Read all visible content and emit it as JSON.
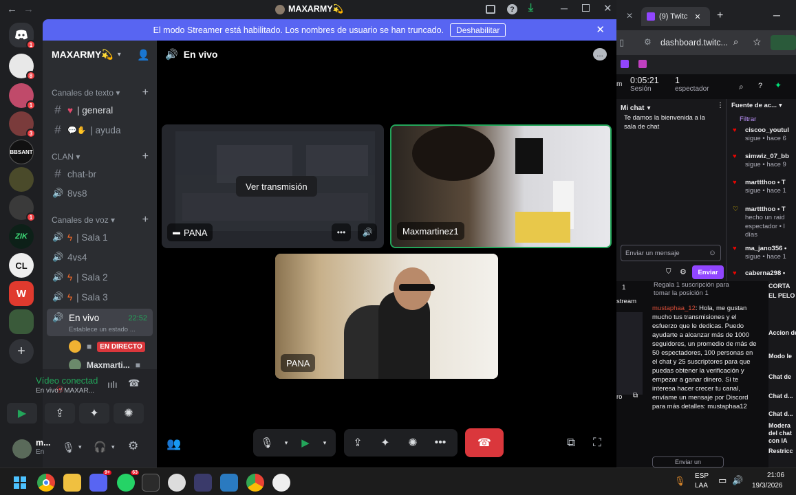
{
  "window": {
    "title": "MAXARMY💫"
  },
  "banner": {
    "text": "El modo Streamer está habilitado. Los nombres de usuario se han truncado.",
    "button": "Deshabilitar"
  },
  "guilds": [
    {
      "label": "",
      "badge": "1",
      "color": "#5865f2"
    },
    {
      "label": "",
      "badge": "8",
      "color": "#e8e8e8"
    },
    {
      "label": "",
      "badge": "1",
      "color": "#c04a6a"
    },
    {
      "label": "",
      "badge": "3",
      "color": "#7a3b3b"
    },
    {
      "label": "BBSANT",
      "badge": "",
      "color": "#111"
    },
    {
      "label": "",
      "badge": "",
      "color": "#4a4a2a"
    },
    {
      "label": "",
      "badge": "1",
      "color": "#3a3a3a"
    },
    {
      "label": "ZIK",
      "badge": "",
      "color": "#0d2018"
    },
    {
      "label": "CL",
      "badge": "",
      "color": "#eeeeee"
    },
    {
      "label": "W",
      "badge": "",
      "color": "#e03a2e"
    },
    {
      "label": "",
      "badge": "",
      "color": "#3a5a3a"
    }
  ],
  "server": {
    "name": "MAXARMY💫"
  },
  "categories": {
    "text": "Canales de texto",
    "clan": "CLAN",
    "voice": "Canales de voz"
  },
  "channels": {
    "general": "| general",
    "ayuda": "| ayuda",
    "chat_br": "chat-br",
    "vs8": "8vs8",
    "sala1": "| Sala 1",
    "vs4": "4vs4",
    "sala2": "| Sala 2",
    "sala3": "| Sala 3",
    "envivo": "En vivo",
    "envivo_time": "22:52",
    "envivo_status": "Establece un estado ..."
  },
  "members": {
    "live_badge": "EN DIRECTO",
    "user2": "Maxmarti..."
  },
  "voice_panel": {
    "status": "Vídeo conectad",
    "sub": "En vivo / MAXAR..."
  },
  "user_panel": {
    "name": "m...",
    "sub": "En"
  },
  "stage": {
    "header": "En vivo",
    "tile1_label": "PANA",
    "tile1_overlay": "Ver transmisión",
    "tile2_label": "Maxmartinez1",
    "tile3_label": "PANA"
  },
  "browser": {
    "tab": "(9) Twitc",
    "url": "dashboard.twitc...",
    "session_time": "0:05:21",
    "session_label": "Sesión",
    "viewers_count": "1",
    "viewers_label": "espectador",
    "mychat": "Mi chat",
    "feed_header": "Fuente de ac...",
    "filter": "Filtrar",
    "welcome": "Te damos la bienvenida a la sala de chat",
    "send_placeholder": "Enviar un mensaje",
    "send_button": "Enviar",
    "feed": [
      {
        "user": "ciscoo_youtul",
        "text": "sigue • hace 6"
      },
      {
        "user": "simwiz_07_bb",
        "text": "sigue • hace 9"
      },
      {
        "user": "marttthoo • T",
        "text": "sigue • hace 1"
      },
      {
        "user": "marttthoo • T",
        "text": "hecho un raid espectador • l días"
      },
      {
        "user": "ma_jano356 •",
        "text": "sigue • hace 1"
      },
      {
        "user": "caberna298 •",
        "text": ""
      }
    ],
    "gift_text": "Regala 1 suscripción para tomar la posición 1",
    "gift_num": "1",
    "stream_label": "stream",
    "spam_user": "mustaphaa_12",
    "spam_text": ": Hola, me gustan mucho tus transmisiones y el esfuerzo que le dedicas. Puedo ayudarte a alcanzar más de 1000 seguidores, un promedio de más de 50 espectadores, 100 personas en el chat y 25 suscriptores para que puedas obtener la verificación y empezar a ganar dinero. Si te interesa hacer crecer tu canal, envíame un mensaje por Discord para más detalles: mustaphaa12",
    "right_items": [
      "CORTA",
      "EL PELO",
      "Accion de ca",
      "Modo le",
      "Chat de",
      "Chat d...",
      "Chat d...",
      "Modera del chat con IA",
      "Restricc"
    ],
    "pro_label": "ro",
    "bottom_send": "Enviar un"
  },
  "taskbar": {
    "lang1": "ESP",
    "lang2": "LAA",
    "time": "21:06",
    "date": "19/3/2026",
    "discord_badge": "9+",
    "whatsapp_badge": "63"
  }
}
